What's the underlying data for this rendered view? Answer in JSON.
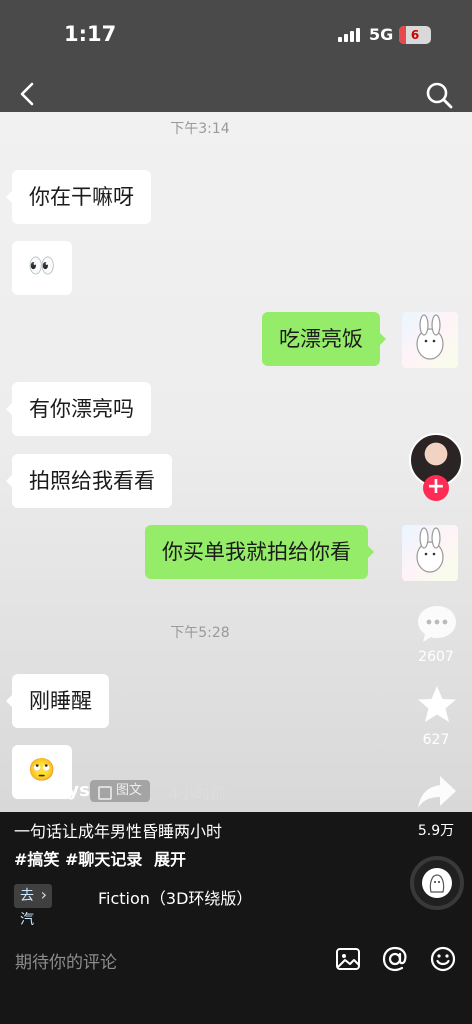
{
  "status_bar": {
    "time": "1:17",
    "network": "5G",
    "battery": "6"
  },
  "chat": {
    "timestamps": [
      "下午3:14",
      "下午5:28"
    ],
    "messages": [
      {
        "from": "friend",
        "text": "你在干嘛呀"
      },
      {
        "from": "friend",
        "emoji": "👀"
      },
      {
        "from": "me",
        "text": "吃漂亮饭"
      },
      {
        "from": "friend",
        "text": "有你漂亮吗"
      },
      {
        "from": "friend",
        "text": "拍照给我看看"
      },
      {
        "from": "me",
        "text": "你买单我就拍给你看"
      },
      {
        "from": "friend",
        "text": "刚睡醒"
      },
      {
        "from": "friend",
        "emoji": "🙄"
      }
    ]
  },
  "side_rail": {
    "follow_label": "+",
    "comments": "2607",
    "likes": "627",
    "shares": "5.9万"
  },
  "post": {
    "author": "@kittys",
    "type_tag": "图文",
    "age": "· 4小时前",
    "caption": "一句话让成年男性昏睡两小时",
    "hashtags": "#搞笑 #聊天记录",
    "expand": "展开",
    "music_chip": "去汽水听",
    "music": "Fiction（3D环绕版）"
  },
  "comment_bar": {
    "placeholder": "期待你的评论"
  },
  "colors": {
    "accent": "#fe2c55",
    "sent_bubble": "#95ec69",
    "background": "#161616"
  },
  "icons": [
    "back-icon",
    "search-icon",
    "comment-icon",
    "like-star-icon",
    "share-icon",
    "image-icon",
    "at-icon",
    "emoji-icon"
  ]
}
